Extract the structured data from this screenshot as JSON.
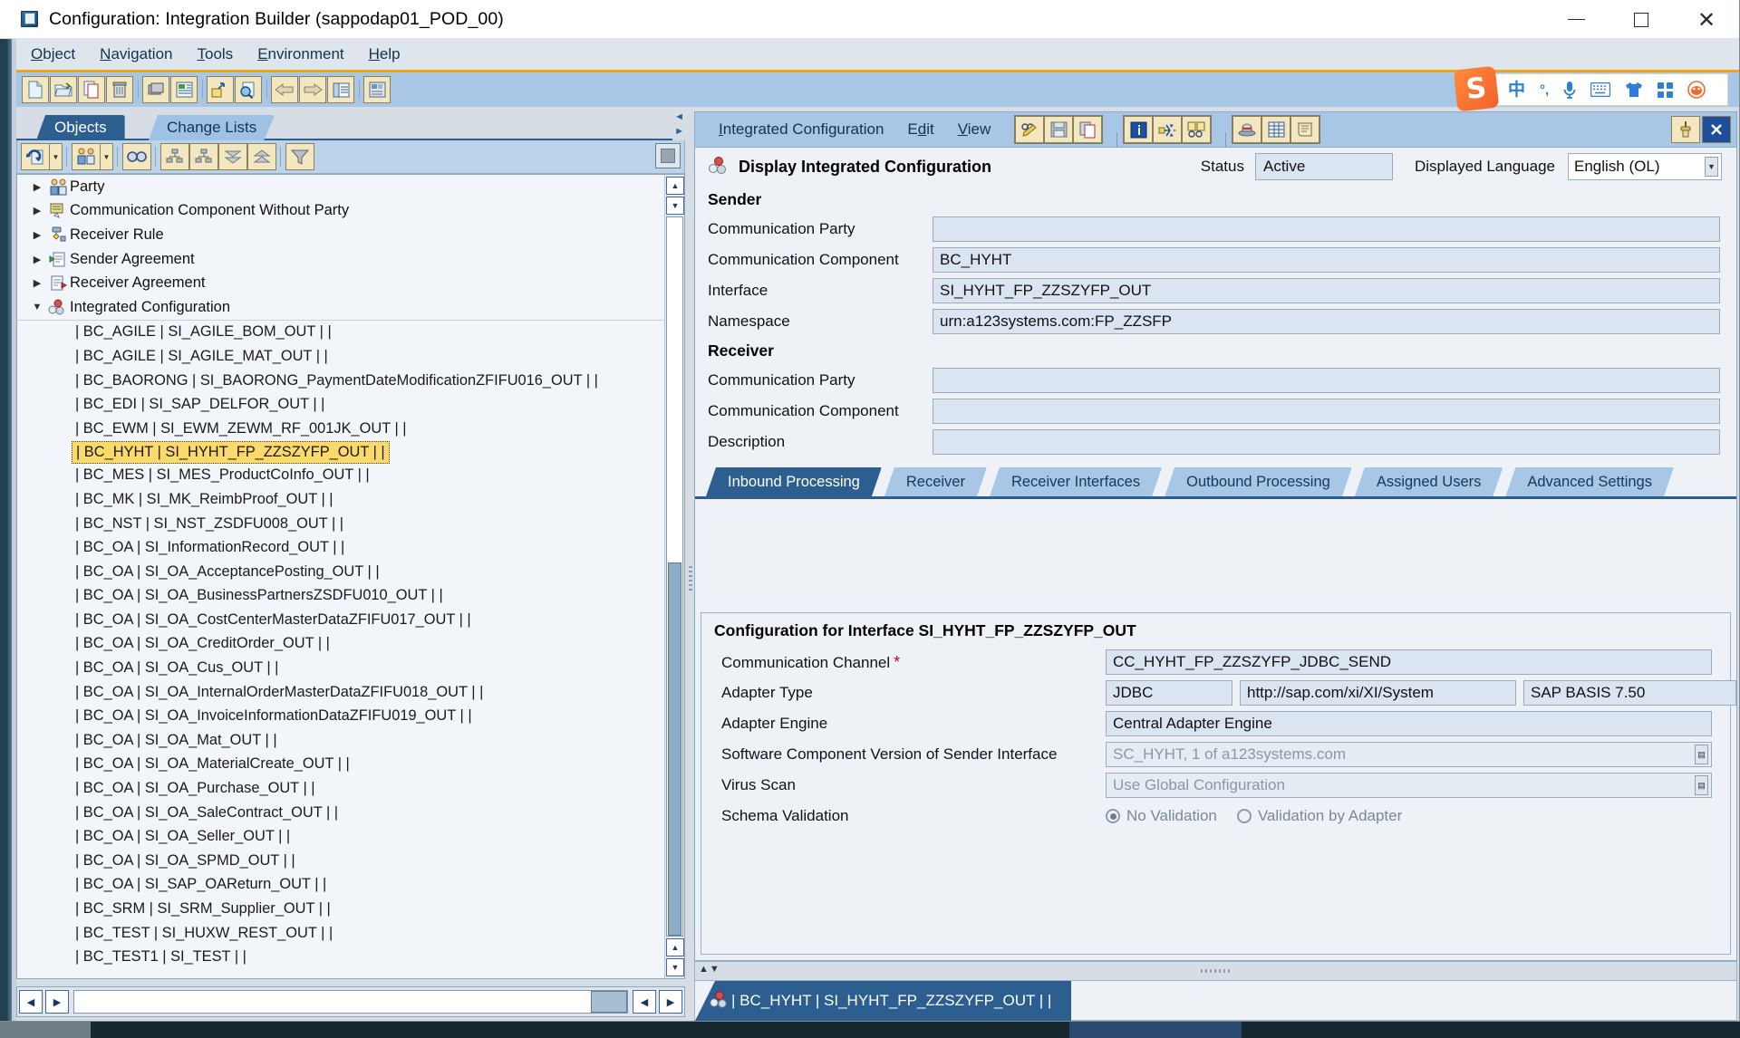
{
  "window": {
    "title": "Configuration: Integration Builder (sappodap01_POD_00)",
    "minimize_label": "Minimize",
    "maximize_label": "Maximize",
    "close_label": "Close"
  },
  "menubar": {
    "items": [
      {
        "label": "Object",
        "accel": "O"
      },
      {
        "label": "Navigation",
        "accel": "N"
      },
      {
        "label": "Tools",
        "accel": "T"
      },
      {
        "label": "Environment",
        "accel": "E"
      },
      {
        "label": "Help",
        "accel": "H"
      }
    ]
  },
  "toolbar": {
    "buttons": [
      {
        "name": "new-icon",
        "tooltip": "New"
      },
      {
        "name": "open-icon",
        "tooltip": "Open"
      },
      {
        "name": "copy-object-icon",
        "tooltip": "Copy Object"
      },
      {
        "name": "delete-icon",
        "tooltip": "Delete"
      },
      {
        "name": "cache-icon",
        "tooltip": "Cache"
      },
      {
        "name": "list-icon",
        "tooltip": "List"
      },
      {
        "name": "export-icon",
        "tooltip": "Export"
      },
      {
        "name": "find-object-icon",
        "tooltip": "Find Object"
      },
      {
        "name": "back-icon",
        "tooltip": "Back"
      },
      {
        "name": "forward-icon",
        "tooltip": "Forward"
      },
      {
        "name": "properties-icon",
        "tooltip": "Properties"
      },
      {
        "name": "scenario-icon",
        "tooltip": "Scenario"
      }
    ]
  },
  "ime": {
    "logo": "S",
    "items": [
      {
        "name": "chinese-mode-icon",
        "glyph": "中"
      },
      {
        "name": "punctuation-icon",
        "glyph": "°,"
      },
      {
        "name": "voice-input-icon",
        "glyph": "🎤"
      },
      {
        "name": "soft-keyboard-icon",
        "glyph": "⌨"
      },
      {
        "name": "skin-icon",
        "glyph": "👕"
      },
      {
        "name": "toolbox-icon",
        "glyph": "▦"
      },
      {
        "name": "sogou-menu-icon",
        "glyph": "◉"
      }
    ]
  },
  "left_panel": {
    "tabs": [
      {
        "label": "Objects",
        "active": true
      },
      {
        "label": "Change Lists",
        "active": false
      }
    ],
    "toolbar_buttons": [
      {
        "name": "refresh-icon",
        "tooltip": "Refresh",
        "has_arrow": true
      },
      {
        "name": "party-filter-icon",
        "tooltip": "Party",
        "has_arrow": true
      },
      {
        "name": "find-icon",
        "tooltip": "Find"
      },
      {
        "name": "expand-subtree-icon",
        "tooltip": "Expand Subtree"
      },
      {
        "name": "collapse-subtree-icon",
        "tooltip": "Collapse Subtree"
      },
      {
        "name": "collapse-all-icon",
        "tooltip": "Collapse All"
      },
      {
        "name": "expand-all-icon",
        "tooltip": "Expand All"
      },
      {
        "name": "filter-icon",
        "tooltip": "Filter"
      },
      {
        "name": "stop-icon",
        "tooltip": "Stop"
      }
    ],
    "tree": [
      {
        "label": "Party",
        "icon": "party-icon",
        "expanded": false,
        "type": "group"
      },
      {
        "label": "Communication Component Without Party",
        "icon": "comm-component-icon",
        "expanded": false,
        "type": "group"
      },
      {
        "label": "Receiver Rule",
        "icon": "receiver-rule-icon",
        "expanded": false,
        "type": "group"
      },
      {
        "label": "Sender Agreement",
        "icon": "sender-agreement-icon",
        "expanded": false,
        "type": "group"
      },
      {
        "label": "Receiver Agreement",
        "icon": "receiver-agreement-icon",
        "expanded": false,
        "type": "group"
      },
      {
        "label": "Integrated Configuration",
        "icon": "integrated-config-icon",
        "expanded": true,
        "type": "group"
      }
    ],
    "leaves": [
      {
        "label": "| BC_AGILE | SI_AGILE_BOM_OUT |  |",
        "selected": false
      },
      {
        "label": "| BC_AGILE | SI_AGILE_MAT_OUT |  |",
        "selected": false
      },
      {
        "label": "| BC_BAORONG | SI_BAORONG_PaymentDateModificationZFIFU016_OUT |  |",
        "selected": false
      },
      {
        "label": "| BC_EDI | SI_SAP_DELFOR_OUT |  |",
        "selected": false
      },
      {
        "label": "| BC_EWM | SI_EWM_ZEWM_RF_001JK_OUT |  |",
        "selected": false
      },
      {
        "label": "| BC_HYHT | SI_HYHT_FP_ZZSZYFP_OUT |  |",
        "selected": true
      },
      {
        "label": "| BC_MES | SI_MES_ProductCoInfo_OUT |  |",
        "selected": false
      },
      {
        "label": "| BC_MK | SI_MK_ReimbProof_OUT |  |",
        "selected": false
      },
      {
        "label": "| BC_NST | SI_NST_ZSDFU008_OUT |  |",
        "selected": false
      },
      {
        "label": "| BC_OA | SI_InformationRecord_OUT |  |",
        "selected": false
      },
      {
        "label": "| BC_OA | SI_OA_AcceptancePosting_OUT |  |",
        "selected": false
      },
      {
        "label": "| BC_OA | SI_OA_BusinessPartnersZSDFU010_OUT |  |",
        "selected": false
      },
      {
        "label": "| BC_OA | SI_OA_CostCenterMasterDataZFIFU017_OUT |  |",
        "selected": false
      },
      {
        "label": "| BC_OA | SI_OA_CreditOrder_OUT |  |",
        "selected": false
      },
      {
        "label": "| BC_OA | SI_OA_Cus_OUT |  |",
        "selected": false
      },
      {
        "label": "| BC_OA | SI_OA_InternalOrderMasterDataZFIFU018_OUT |  |",
        "selected": false
      },
      {
        "label": "| BC_OA | SI_OA_InvoiceInformationDataZFIFU019_OUT |  |",
        "selected": false
      },
      {
        "label": "| BC_OA | SI_OA_Mat_OUT |  |",
        "selected": false
      },
      {
        "label": "| BC_OA | SI_OA_MaterialCreate_OUT |  |",
        "selected": false
      },
      {
        "label": "| BC_OA | SI_OA_Purchase_OUT |  |",
        "selected": false
      },
      {
        "label": "| BC_OA | SI_OA_SaleContract_OUT |  |",
        "selected": false
      },
      {
        "label": "| BC_OA | SI_OA_Seller_OUT |  |",
        "selected": false
      },
      {
        "label": "| BC_OA | SI_OA_SPMD_OUT |  |",
        "selected": false
      },
      {
        "label": "| BC_OA | SI_SAP_OAReturn_OUT |  |",
        "selected": false
      },
      {
        "label": "| BC_SRM | SI_SRM_Supplier_OUT |  |",
        "selected": false
      },
      {
        "label": "| BC_TEST | SI_HUXW_REST_OUT |  |",
        "selected": false
      },
      {
        "label": "| BC_TEST1 | SI_TEST |  |",
        "selected": false
      }
    ]
  },
  "right_panel": {
    "menus": [
      {
        "label": "Integrated Configuration",
        "accel": "I"
      },
      {
        "label": "Edit",
        "accel": "d"
      },
      {
        "label": "View",
        "accel": "V"
      }
    ],
    "toolbar_buttons": [
      {
        "name": "edit-icon",
        "tooltip": "Switch Between Display and Edit"
      },
      {
        "name": "save-icon",
        "tooltip": "Save"
      },
      {
        "name": "copy-icon",
        "tooltip": "Copy"
      },
      {
        "name": "info-icon",
        "tooltip": "Information"
      },
      {
        "name": "where-used-icon",
        "tooltip": "Where-Used List"
      },
      {
        "name": "display-doc-icon",
        "tooltip": "Display Documentation"
      },
      {
        "name": "history-icon",
        "tooltip": "History"
      },
      {
        "name": "table-icon",
        "tooltip": "Table View"
      },
      {
        "name": "log-icon",
        "tooltip": "Log"
      }
    ],
    "right_buttons": [
      {
        "name": "pin-icon",
        "tooltip": "Pin"
      },
      {
        "name": "close-panel-icon",
        "tooltip": "Close"
      }
    ],
    "header": {
      "icon": "integrated-config-icon",
      "title": "Display Integrated Configuration",
      "status_label": "Status",
      "status_value": "Active",
      "language_label": "Displayed Language",
      "language_value": "English (OL)"
    },
    "sender": {
      "section_title": "Sender",
      "fields": [
        {
          "label": "Communication Party",
          "value": ""
        },
        {
          "label": "Communication Component",
          "value": "BC_HYHT"
        },
        {
          "label": "Interface",
          "value": "SI_HYHT_FP_ZZSZYFP_OUT"
        },
        {
          "label": "Namespace",
          "value": "urn:a123systems.com:FP_ZZSFP"
        }
      ]
    },
    "receiver": {
      "section_title": "Receiver",
      "fields": [
        {
          "label": "Communication Party",
          "value": ""
        },
        {
          "label": "Communication Component",
          "value": ""
        },
        {
          "label": "Description",
          "value": ""
        }
      ]
    },
    "tabs": [
      {
        "label": "Inbound Processing",
        "active": true
      },
      {
        "label": "Receiver",
        "active": false
      },
      {
        "label": "Receiver Interfaces",
        "active": false
      },
      {
        "label": "Outbound Processing",
        "active": false
      },
      {
        "label": "Assigned Users",
        "active": false
      },
      {
        "label": "Advanced Settings",
        "active": false
      }
    ],
    "inbound": {
      "title": "Configuration for Interface SI_HYHT_FP_ZZSZYFP_OUT",
      "channel_label": "Communication Channel",
      "channel_required": "*",
      "channel_value": "CC_HYHT_FP_ZZSZYFP_JDBC_SEND",
      "adapter_type_label": "Adapter Type",
      "adapter_type_value": "JDBC",
      "adapter_namespace_value": "http://sap.com/xi/XI/System",
      "adapter_swcv_value": "SAP BASIS 7.50",
      "adapter_engine_label": "Adapter Engine",
      "adapter_engine_value": "Central Adapter Engine",
      "swcv_label": "Software Component Version of Sender Interface",
      "swcv_value": "SC_HYHT, 1 of a123systems.com",
      "virus_scan_label": "Virus Scan",
      "virus_scan_value": "Use Global Configuration",
      "schema_label": "Schema Validation",
      "schema_option_1": "No Validation",
      "schema_option_2": "Validation by Adapter",
      "schema_selected": "No Validation"
    },
    "status_tab": {
      "icon": "integrated-config-icon",
      "label": "| BC_HYHT | SI_HYHT_FP_ZZSZYFP_OUT |  |"
    }
  },
  "colors": {
    "accent_blue": "#2c5f8f",
    "toolbar_blue": "#a8c6e6",
    "selection_yellow": "#fbd96a",
    "orange_rule": "#f5a316",
    "field_blue": "#dbe5f1"
  }
}
